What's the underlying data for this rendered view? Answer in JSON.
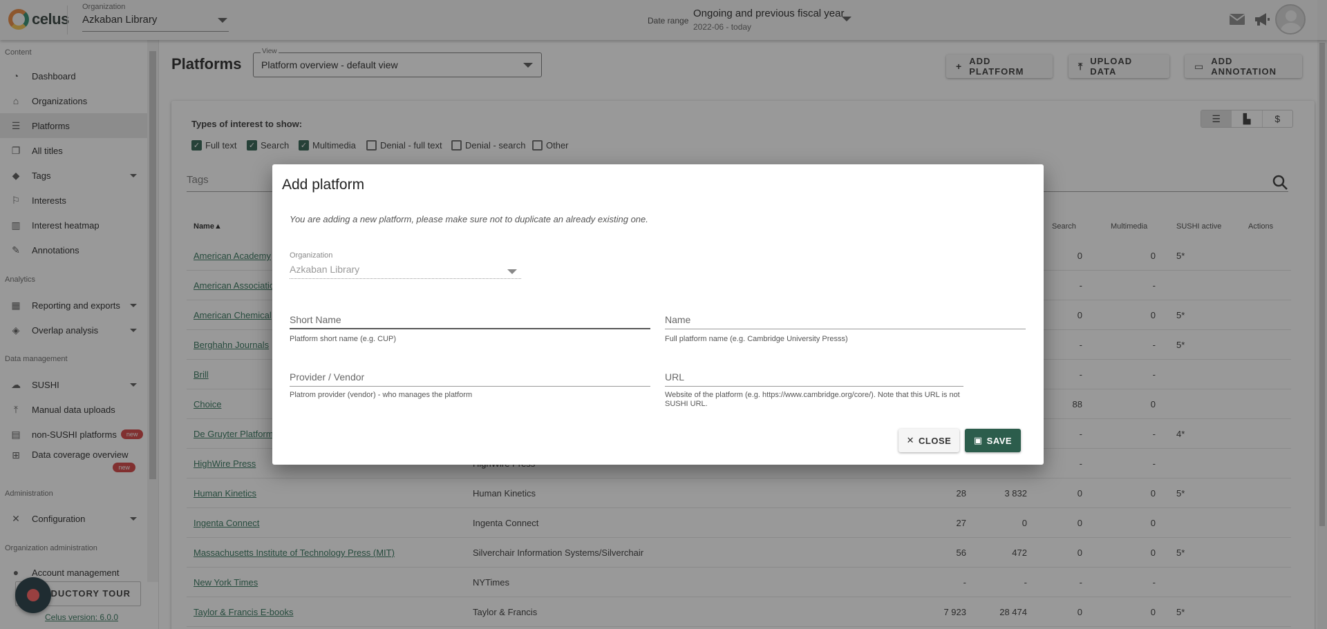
{
  "topbar": {
    "logo_text": "celus",
    "org_label": "Organization",
    "org_value": "Azkaban Library",
    "date_label": "Date range",
    "date_value": "Ongoing and previous fiscal year",
    "date_sub": "2022-06 - today"
  },
  "sidebar": {
    "sections": {
      "content": "Content",
      "analytics": "Analytics",
      "data_management": "Data management",
      "administration": "Administration",
      "org_admin": "Organization administration"
    },
    "items": [
      {
        "label": "Dashboard"
      },
      {
        "label": "Organizations"
      },
      {
        "label": "Platforms"
      },
      {
        "label": "All titles"
      },
      {
        "label": "Tags"
      },
      {
        "label": "Interests"
      },
      {
        "label": "Interest heatmap"
      },
      {
        "label": "Annotations"
      },
      {
        "label": "Reporting and exports"
      },
      {
        "label": "Overlap analysis"
      },
      {
        "label": "SUSHI"
      },
      {
        "label": "Manual data uploads"
      },
      {
        "label": "non-SUSHI platforms"
      },
      {
        "label": "Data coverage overview"
      },
      {
        "label": "Configuration"
      },
      {
        "label": "Account management"
      }
    ],
    "new_badge": "new",
    "intro_tour": "ODUCTORY TOUR",
    "version": "Celus version: 6.0.0"
  },
  "main": {
    "title": "Platforms",
    "view_label": "View",
    "view_value": "Platform overview - default view",
    "buttons": {
      "add_platform": "ADD PLATFORM",
      "upload_data": "UPLOAD DATA",
      "add_annotation": "ADD ANNOTATION"
    },
    "types_label": "Types of interest to show:",
    "types": [
      {
        "label": "Full text",
        "checked": true
      },
      {
        "label": "Search",
        "checked": true
      },
      {
        "label": "Multimedia",
        "checked": true
      },
      {
        "label": "Denial - full text",
        "checked": false
      },
      {
        "label": "Denial - search",
        "checked": false
      },
      {
        "label": "Other",
        "checked": false
      }
    ],
    "tags_placeholder": "Tags",
    "columns": {
      "name": "Name",
      "search": "Search",
      "multimedia": "Multimedia",
      "sushi": "SUSHI active",
      "actions": "Actions"
    },
    "rows": [
      {
        "name": "American Academy",
        "provider": "",
        "c1": "",
        "c2": "",
        "search": "0",
        "multimedia": "0",
        "sushi": "5*"
      },
      {
        "name": "American Associatio",
        "provider": "",
        "c1": "",
        "c2": "",
        "search": "-",
        "multimedia": "-",
        "sushi": ""
      },
      {
        "name": "American Chemical",
        "provider": "",
        "c1": "",
        "c2": "",
        "search": "0",
        "multimedia": "0",
        "sushi": "5*"
      },
      {
        "name": "Berghahn Journals",
        "provider": "",
        "c1": "",
        "c2": "",
        "search": "-",
        "multimedia": "-",
        "sushi": "5*"
      },
      {
        "name": "Brill",
        "provider": "",
        "c1": "",
        "c2": "",
        "search": "-",
        "multimedia": "-",
        "sushi": ""
      },
      {
        "name": "Choice",
        "provider": "",
        "c1": "",
        "c2": "",
        "search": "88",
        "multimedia": "0",
        "sushi": ""
      },
      {
        "name": "De Gruyter Platform",
        "provider": "",
        "c1": "",
        "c2": "",
        "search": "-",
        "multimedia": "-",
        "sushi": "4*"
      },
      {
        "name": "HighWire Press",
        "provider": "HighWire Press",
        "c1": "",
        "c2": "",
        "search": "-",
        "multimedia": "-",
        "sushi": ""
      },
      {
        "name": "Human Kinetics",
        "provider": "Human Kinetics",
        "c1": "28",
        "c2": "3 832",
        "search": "0",
        "multimedia": "0",
        "sushi": "5*"
      },
      {
        "name": "Ingenta Connect",
        "provider": "Ingenta Connect",
        "c1": "27",
        "c2": "0",
        "search": "0",
        "multimedia": "0",
        "sushi": ""
      },
      {
        "name": "Massachusetts Institute of Technology Press (MIT)",
        "provider": "Silverchair Information Systems/Silverchair",
        "c1": "56",
        "c2": "472",
        "search": "0",
        "multimedia": "0",
        "sushi": "5*"
      },
      {
        "name": "New York Times",
        "provider": "NYTimes",
        "c1": "-",
        "c2": "-",
        "search": "-",
        "multimedia": "-",
        "sushi": ""
      },
      {
        "name": "Taylor & Francis E-books",
        "provider": "Taylor & Francis",
        "c1": "7 923",
        "c2": "28 474",
        "search": "0",
        "multimedia": "0",
        "sushi": "5*"
      }
    ]
  },
  "dialog": {
    "title": "Add platform",
    "note": "You are adding a new platform, please make sure not to duplicate an already existing one.",
    "org_label": "Organization",
    "org_value": "Azkaban Library",
    "short_name_placeholder": "Short Name",
    "short_name_hint": "Platform short name (e.g. CUP)",
    "name_placeholder": "Name",
    "name_hint": "Full platform name (e.g. Cambridge University Presss)",
    "provider_placeholder": "Provider / Vendor",
    "provider_hint": "Platrom provider (vendor) - who manages the platform",
    "url_placeholder": "URL",
    "url_hint": "Website of the platform (e.g. https://www.cambridge.org/core/). Note that this URL is not SUSHI URL.",
    "close_label": "CLOSE",
    "save_label": "SAVE"
  },
  "colors": {
    "accent": "#2c5d4c",
    "link": "#2c6f55",
    "badge": "#d23d3d"
  }
}
